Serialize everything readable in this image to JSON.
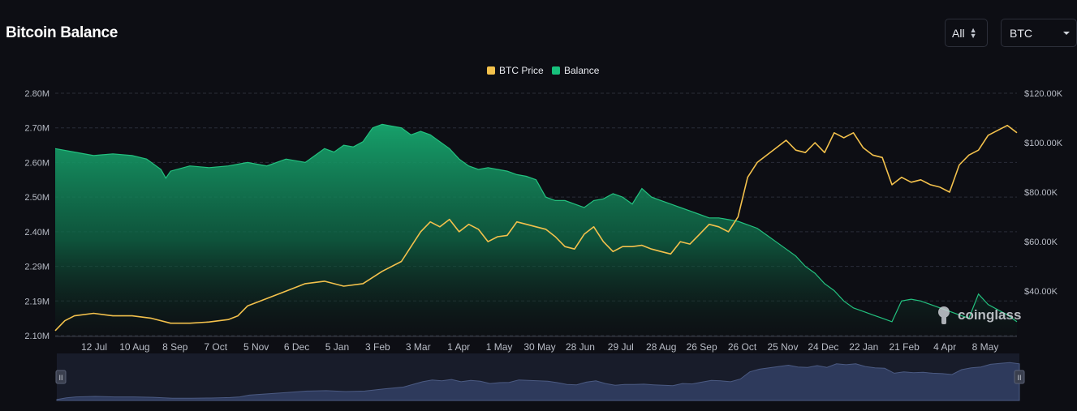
{
  "header": {
    "title": "Bitcoin Balance",
    "range_select": "All",
    "asset_select": "BTC"
  },
  "watermark": "coinglass",
  "colors": {
    "background": "#0d0e14",
    "price_line": "#f3c14c",
    "balance_fill": "#17a86f",
    "balance_line": "#23c17f",
    "grid": "#2a2d38",
    "axis_text": "#b8bcc6",
    "navigator_fill": "#2e3a5c"
  },
  "chart_data": {
    "type": "area",
    "title": "Bitcoin Balance",
    "legend": {
      "position": "top-center",
      "entries": [
        "BTC Price",
        "Balance"
      ]
    },
    "grid": true,
    "x_ticks": [
      "12 Jul",
      "10 Aug",
      "8 Sep",
      "7 Oct",
      "5 Nov",
      "6 Dec",
      "5 Jan",
      "3 Feb",
      "3 Mar",
      "1 Apr",
      "1 May",
      "30 May",
      "28 Jun",
      "29 Jul",
      "28 Aug",
      "26 Sep",
      "26 Oct",
      "25 Nov",
      "24 Dec",
      "22 Jan",
      "21 Feb",
      "4 Apr",
      "8 May"
    ],
    "y_left": {
      "label": "Balance",
      "ticks": [
        "2.10M",
        "2.19M",
        "2.29M",
        "2.40M",
        "2.50M",
        "2.60M",
        "2.70M",
        "2.80M"
      ],
      "range": [
        2100000,
        2800000
      ]
    },
    "y_right": {
      "label": "BTC Price",
      "ticks": [
        "$40.00K",
        "$60.00K",
        "$80.00K",
        "$100.00K",
        "$120.00K"
      ],
      "range": [
        22000,
        120000
      ]
    },
    "x_range": [
      0,
      1
    ],
    "series": [
      {
        "name": "Balance",
        "axis": "left",
        "x": [
          0,
          0.02,
          0.04,
          0.06,
          0.08,
          0.095,
          0.11,
          0.115,
          0.12,
          0.14,
          0.16,
          0.18,
          0.2,
          0.22,
          0.24,
          0.26,
          0.27,
          0.28,
          0.29,
          0.3,
          0.31,
          0.32,
          0.33,
          0.34,
          0.35,
          0.36,
          0.37,
          0.38,
          0.39,
          0.4,
          0.41,
          0.42,
          0.43,
          0.44,
          0.45,
          0.46,
          0.47,
          0.48,
          0.49,
          0.5,
          0.51,
          0.52,
          0.53,
          0.54,
          0.55,
          0.56,
          0.57,
          0.58,
          0.59,
          0.6,
          0.61,
          0.62,
          0.63,
          0.64,
          0.65,
          0.66,
          0.67,
          0.68,
          0.69,
          0.7,
          0.71,
          0.72,
          0.73,
          0.74,
          0.75,
          0.76,
          0.77,
          0.78,
          0.79,
          0.8,
          0.81,
          0.82,
          0.83,
          0.84,
          0.85,
          0.86,
          0.87,
          0.88,
          0.89,
          0.9,
          0.91,
          0.92,
          0.93,
          0.94,
          0.95,
          0.96,
          0.97,
          0.98,
          0.99,
          1
        ],
        "values": [
          2640000,
          2630000,
          2620000,
          2625000,
          2620000,
          2610000,
          2580000,
          2555000,
          2575000,
          2590000,
          2585000,
          2590000,
          2600000,
          2590000,
          2610000,
          2600000,
          2620000,
          2640000,
          2630000,
          2650000,
          2645000,
          2660000,
          2700000,
          2710000,
          2705000,
          2700000,
          2680000,
          2690000,
          2680000,
          2660000,
          2640000,
          2610000,
          2590000,
          2580000,
          2585000,
          2580000,
          2575000,
          2565000,
          2560000,
          2550000,
          2500000,
          2490000,
          2490000,
          2480000,
          2470000,
          2490000,
          2495000,
          2510000,
          2500000,
          2480000,
          2525000,
          2500000,
          2490000,
          2480000,
          2470000,
          2460000,
          2450000,
          2440000,
          2440000,
          2435000,
          2430000,
          2420000,
          2410000,
          2390000,
          2370000,
          2350000,
          2330000,
          2300000,
          2280000,
          2250000,
          2230000,
          2200000,
          2180000,
          2170000,
          2160000,
          2150000,
          2140000,
          2200000,
          2205000,
          2200000,
          2190000,
          2180000,
          2170000,
          2160000,
          2150000,
          2220000,
          2190000,
          2175000,
          2160000,
          2140000
        ]
      },
      {
        "name": "BTC Price",
        "axis": "right",
        "x": [
          0,
          0.01,
          0.02,
          0.04,
          0.06,
          0.08,
          0.1,
          0.12,
          0.14,
          0.16,
          0.18,
          0.19,
          0.2,
          0.22,
          0.24,
          0.26,
          0.28,
          0.3,
          0.32,
          0.34,
          0.36,
          0.38,
          0.39,
          0.4,
          0.41,
          0.42,
          0.43,
          0.44,
          0.45,
          0.46,
          0.47,
          0.48,
          0.49,
          0.5,
          0.51,
          0.52,
          0.53,
          0.54,
          0.55,
          0.56,
          0.57,
          0.58,
          0.59,
          0.6,
          0.61,
          0.62,
          0.63,
          0.64,
          0.65,
          0.66,
          0.67,
          0.68,
          0.69,
          0.7,
          0.71,
          0.72,
          0.73,
          0.74,
          0.75,
          0.76,
          0.77,
          0.78,
          0.79,
          0.8,
          0.81,
          0.82,
          0.83,
          0.84,
          0.85,
          0.86,
          0.87,
          0.88,
          0.89,
          0.9,
          0.91,
          0.92,
          0.93,
          0.94,
          0.95,
          0.96,
          0.97,
          0.98,
          0.99,
          1
        ],
        "values": [
          24000,
          28000,
          30000,
          31000,
          30000,
          30000,
          29000,
          27000,
          27000,
          27500,
          28500,
          30000,
          34000,
          37000,
          40000,
          43000,
          44000,
          42000,
          43000,
          48000,
          52000,
          64000,
          68000,
          66000,
          69000,
          64000,
          67000,
          65000,
          60000,
          62000,
          62500,
          68000,
          67000,
          66000,
          65000,
          62000,
          58000,
          57000,
          63000,
          66000,
          60000,
          56000,
          58000,
          58000,
          58500,
          57000,
          56000,
          55000,
          60000,
          59000,
          63000,
          67000,
          66000,
          64000,
          70000,
          86000,
          92000,
          95000,
          98000,
          101000,
          97000,
          96000,
          100000,
          96000,
          104000,
          102000,
          104000,
          98000,
          95000,
          94000,
          83000,
          86000,
          84000,
          85000,
          83000,
          82000,
          80000,
          91000,
          95000,
          97000,
          103000,
          105000,
          107000,
          104000
        ]
      }
    ]
  }
}
